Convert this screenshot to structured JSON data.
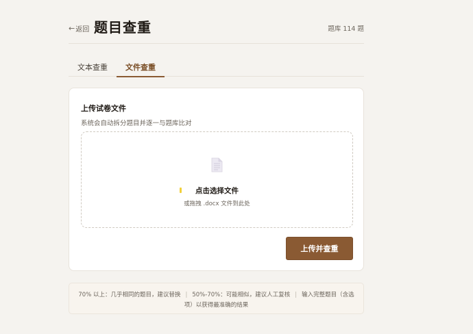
{
  "header": {
    "back_label": "返回",
    "title": "题目查重",
    "bank_count": "题库 114 题"
  },
  "tabs": [
    {
      "label": "文本查重",
      "active": false
    },
    {
      "label": "文件查重",
      "active": true
    }
  ],
  "card": {
    "title": "上传试卷文件",
    "description": "系统会自动拆分题目并逐一与题库比对",
    "dropzone": {
      "title": "点击选择文件",
      "hint": "或拖拽 .docx 文件到此处",
      "icon": "document-icon"
    },
    "upload_button": "上传并查重"
  },
  "notes": {
    "item1": "70% 以上：几乎相同的题目，建议替换",
    "item2": "50%-70%：可能相似，建议人工复核",
    "item3a": "输入完整题目（含选",
    "item3b": "项）以获得最准确的结果"
  },
  "colors": {
    "accent": "#8a5a33",
    "background": "#f5f3ef",
    "marker": "#f2d03a"
  }
}
